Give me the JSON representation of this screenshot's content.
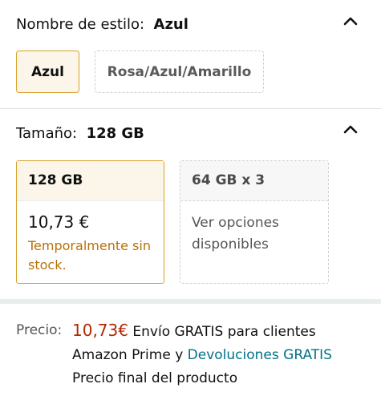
{
  "style": {
    "label": "Nombre de estilo:",
    "value": "Azul",
    "options": [
      "Azul",
      "Rosa/Azul/Amarillo"
    ]
  },
  "size": {
    "label": "Tamaño:",
    "value": "128 GB",
    "cards": [
      {
        "title": "128 GB",
        "price": "10,73 €",
        "status": "Temporalmente sin stock."
      },
      {
        "title": "64 GB x 3",
        "status": "Ver opciones disponibles"
      }
    ]
  },
  "price": {
    "label": "Precio:",
    "amount": "10,73€",
    "shipping": " Envío GRATIS para clientes Amazon Prime y ",
    "returns_link": "Devoluciones GRATIS",
    "final_note": "Precio final del producto"
  },
  "icons": {
    "collapse": "chevron-up-icon"
  },
  "colors": {
    "selected_border": "#d9a02a",
    "price_red": "#b12704",
    "link_teal": "#007185",
    "stock_orange": "#b7710b"
  }
}
